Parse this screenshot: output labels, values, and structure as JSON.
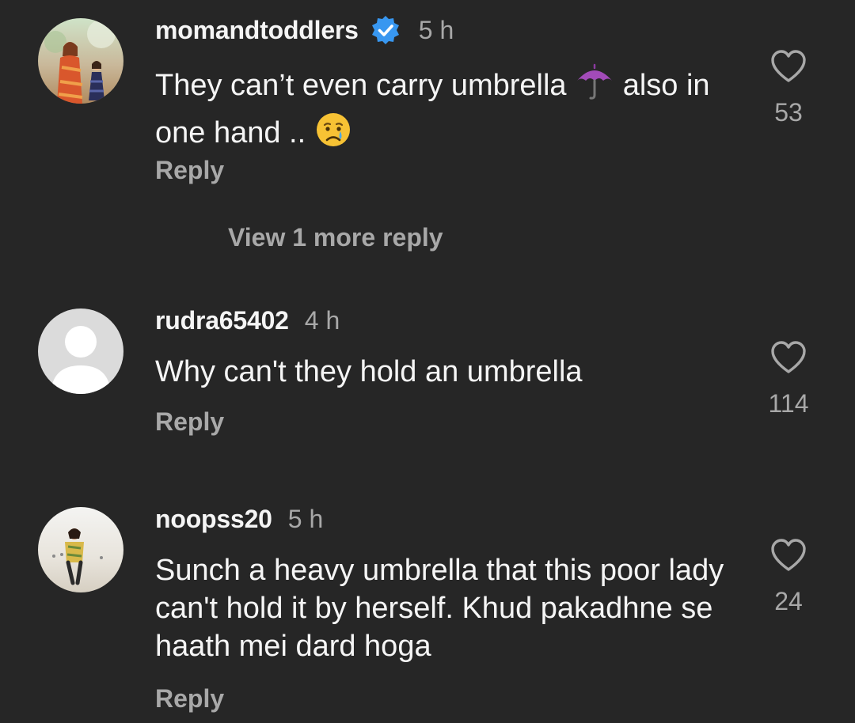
{
  "comments": [
    {
      "username": "momandtoddlers",
      "verified": true,
      "time": "5 h",
      "text_part1": "They can’t even carry umbrella",
      "emoji1": "umbrella-emoji",
      "text_part2": "also in one hand ..",
      "emoji2": "crying-face-emoji",
      "reply_label": "Reply",
      "likes": "53",
      "view_more": "View 1 more reply"
    },
    {
      "username": "rudra65402",
      "verified": false,
      "time": "4 h",
      "text": "Why can't they hold an umbrella",
      "reply_label": "Reply",
      "likes": "114"
    },
    {
      "username": "noopss20",
      "verified": false,
      "time": "5 h",
      "text": "Sunch a heavy umbrella that this poor lady can't hold it by herself. Khud pakadhne se haath mei dard hoga",
      "reply_label": "Reply",
      "likes": "24"
    }
  ],
  "colors": {
    "background": "#262626",
    "text_primary": "#f5f5f5",
    "text_secondary": "#a8a8a8",
    "verified_blue": "#3897f0"
  }
}
